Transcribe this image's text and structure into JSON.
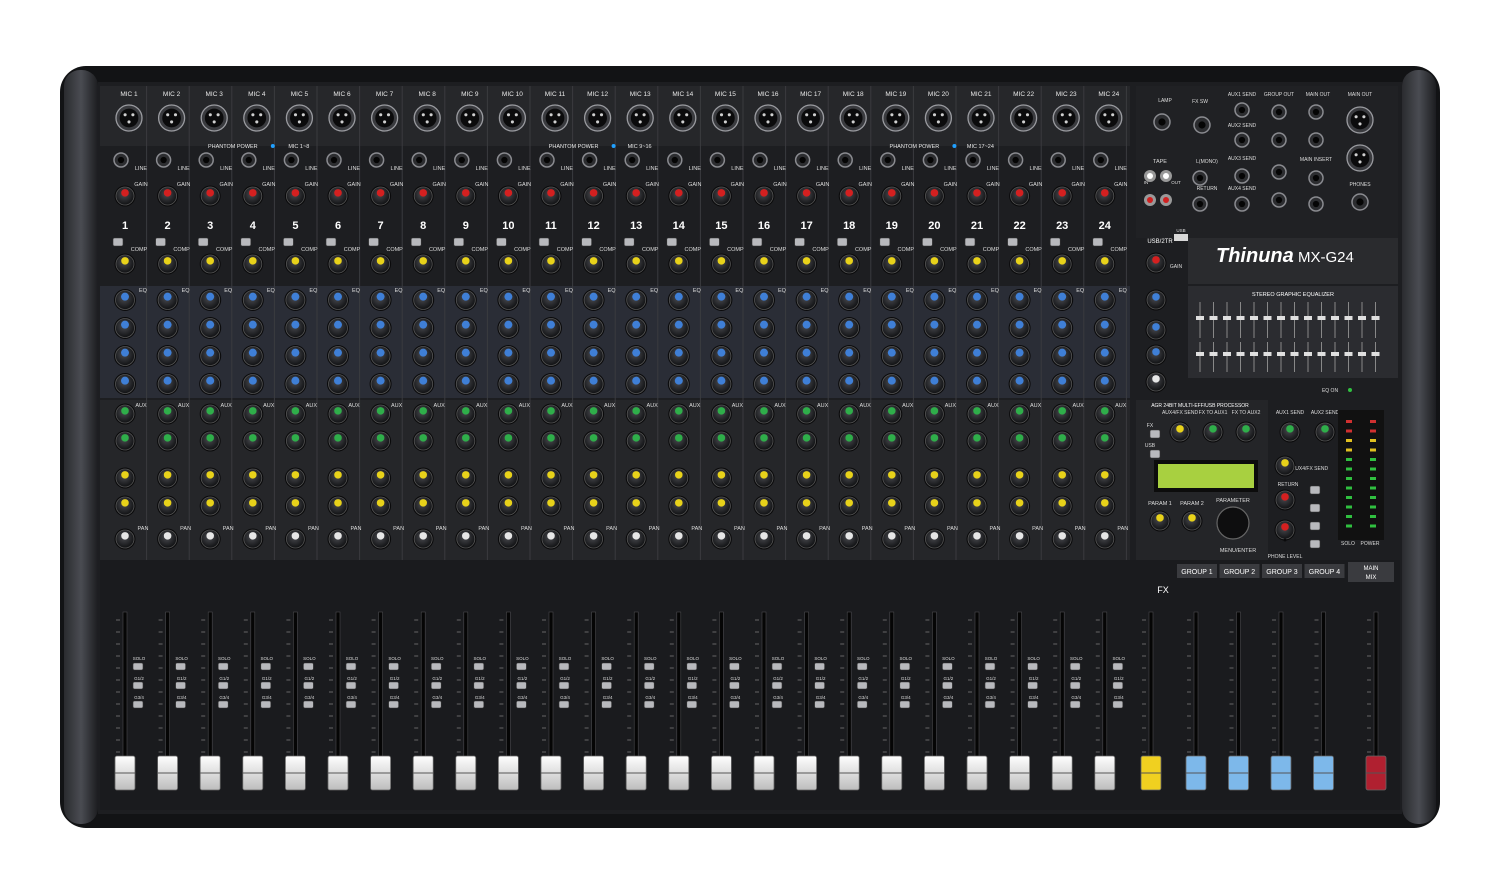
{
  "brand": {
    "name": "Thinuna",
    "model": "MX-G24"
  },
  "channels": {
    "mic_labels": [
      "MIC 1",
      "MIC 2",
      "MIC 3",
      "MIC 4",
      "MIC 5",
      "MIC 6",
      "MIC 7",
      "MIC 8",
      "MIC 9",
      "MIC 10",
      "MIC 11",
      "MIC 12",
      "MIC 13",
      "MIC 14",
      "MIC 15",
      "MIC 16",
      "MIC 17",
      "MIC 18",
      "MIC 19",
      "MIC 20",
      "MIC 21",
      "MIC 22",
      "MIC 23",
      "MIC 24"
    ],
    "numbers": [
      "1",
      "2",
      "3",
      "4",
      "5",
      "6",
      "7",
      "8",
      "9",
      "10",
      "11",
      "12",
      "13",
      "14",
      "15",
      "16",
      "17",
      "18",
      "19",
      "20",
      "21",
      "22",
      "23",
      "24"
    ],
    "strip_labels": {
      "line": "LINE",
      "gain": "GAIN",
      "comp": "COMP",
      "eq": "EQ",
      "aux": "AUX",
      "pan": "PAN",
      "mute": "MUTE",
      "solo": "SOLO",
      "g12": "G1/2",
      "g34": "G3/4"
    }
  },
  "phantom": [
    {
      "label": "PHANTOM POWER",
      "range": "MIC 1~8"
    },
    {
      "label": "PHANTOM POWER",
      "range": "MIC 9~16"
    },
    {
      "label": "PHANTOM POWER",
      "range": "MIC 17~24"
    }
  ],
  "master": {
    "usb_label": "USB/2TR",
    "usb_jack": "USB",
    "lamp": "LAMP",
    "fx_sw": "FX SW",
    "tape": "TAPE",
    "tape_in": "IN",
    "tape_out": "OUT",
    "aux1_send": "AUX1 SEND",
    "aux2_send": "AUX2 SEND",
    "aux3_send": "AUX3 SEND",
    "aux4_send": "AUX4 SEND",
    "lmono": "L(MONO)",
    "return": "RETURN",
    "group_out": "GROUP OUT",
    "main_out": "MAIN OUT",
    "main_insert": "MAIN INSERT",
    "phones": "PHONES",
    "gain": "GAIN",
    "graphic_eq": "STEREO GRAPHIC EQUALIZER",
    "processor": "AGR 24BIT MULTI-EFF/USB PROCESSOR",
    "aux_fx_send": "AUX4/FX SEND",
    "fx_to_aux1": "FX TO AUX1",
    "fx_to_aux2": "FX TO AUX2",
    "param1": "PARAM 1",
    "param2": "PARAM 2",
    "parameter": "PARAMETER",
    "menu_enter": "MENU/ENTER",
    "phone_level": "PHONE LEVEL",
    "solo": "SOLO",
    "power": "POWER",
    "fx": "FX",
    "fx_btn": "FX",
    "usb_btn": "USB",
    "eq_on": "EQ ON"
  },
  "fader_labels": {
    "fx": "FX",
    "groups": [
      "GROUP 1",
      "GROUP 2",
      "GROUP 3",
      "GROUP 4"
    ],
    "main": "MAIN MIX"
  },
  "colors": {
    "panel": "#1b1c1f",
    "knob_red": "#d42020",
    "knob_yellow": "#e8d21a",
    "knob_blue": "#3f7fd6",
    "knob_green": "#2fae4a",
    "knob_white": "#e6e6e6",
    "fader_fx": "#f0d020",
    "fader_group": "#7db8ea",
    "fader_main": "#b02030",
    "lcd": "#a8d040"
  }
}
